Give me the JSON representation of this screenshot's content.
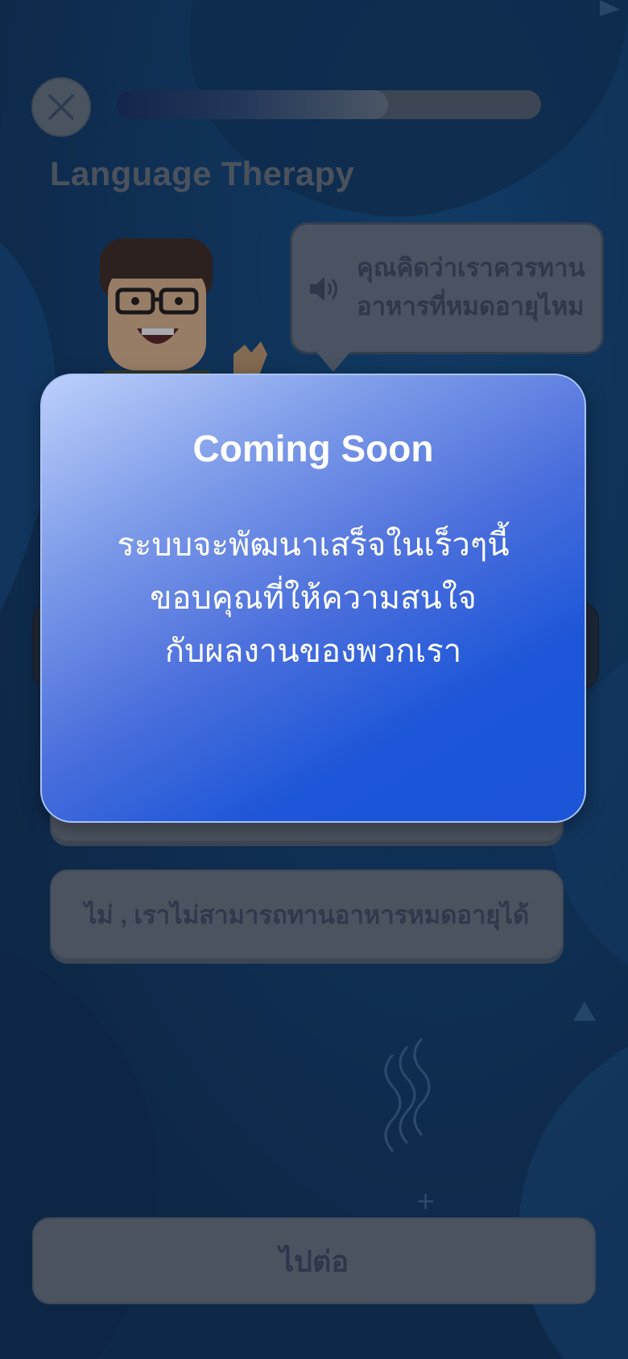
{
  "header": {
    "close_icon": "close-icon",
    "progress_fraction": 0.64,
    "title": "Language Therapy"
  },
  "question": {
    "speaker_icon": "speaker-icon",
    "text_line1": "คุณคิดว่าเราควรทาน",
    "text_line2": "อาหารที่หมดอายุไหม"
  },
  "options": [
    {
      "label": ""
    },
    {
      "label": "ไม่ , เราไม่สามารถทานอาหารหมดอายุได้"
    }
  ],
  "footer": {
    "next_label": "ไปต่อ"
  },
  "modal": {
    "title": "Coming Soon",
    "body_line1": "ระบบจะพัฒนาเสร็จในเร็วๆนี้",
    "body_line2": "ขอบคุณที่ให้ความสนใจ",
    "body_line3": "กับผลงานของพวกเรา"
  },
  "colors": {
    "background": "#0d3a6d",
    "modal_accent": "#1b55d8"
  }
}
